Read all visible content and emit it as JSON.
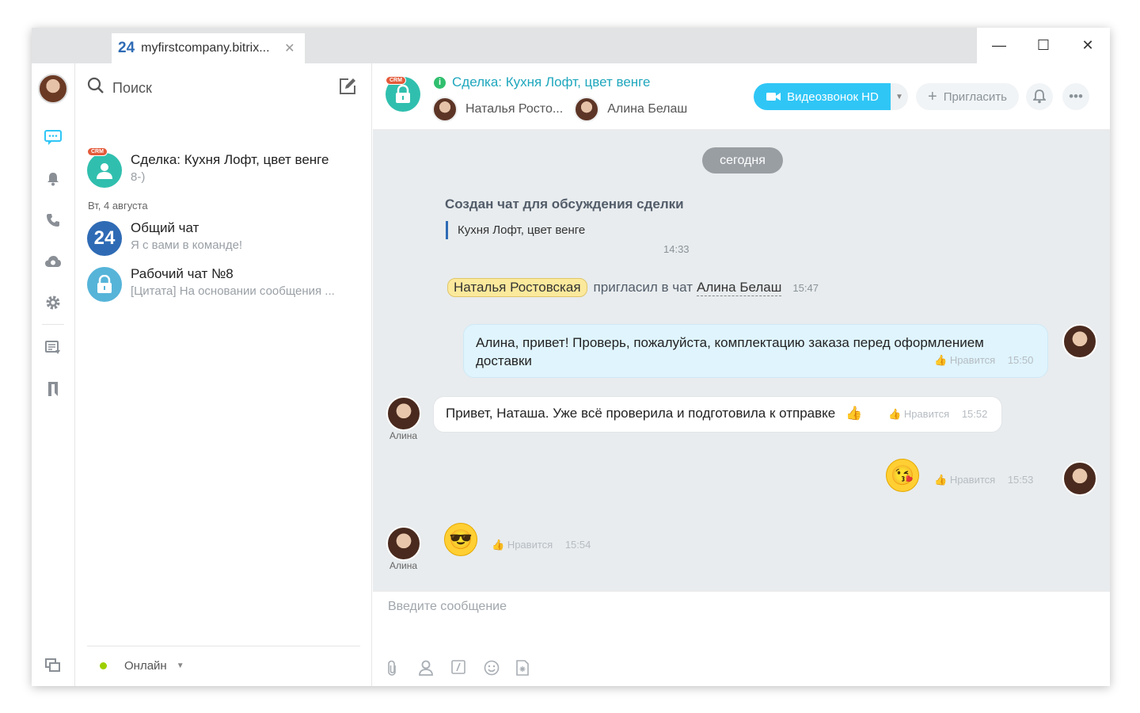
{
  "window": {
    "tab_logo": "24",
    "tab_title": "myfirstcompany.bitrix...",
    "tab_close": "✕",
    "minimize": "—",
    "maximize": "☐",
    "close": "✕"
  },
  "sidebar": {
    "active_color": "#2fc6f6"
  },
  "search": {
    "placeholder": "Поиск"
  },
  "chat_list": {
    "date_separator": "Вт, 4 августа",
    "items": [
      {
        "name": "Сделка: Кухня Лофт, цвет венге",
        "preview": "8-)",
        "badge": "CRM"
      },
      {
        "name": "Общий чат",
        "preview": "Я с вами в команде!",
        "avatar_text": "24"
      },
      {
        "name": "Рабочий чат №8",
        "preview": "[Цитата] На основании сообщения ..."
      }
    ]
  },
  "status": {
    "label": "Онлайн"
  },
  "chat": {
    "badge": "CRM",
    "title": "Сделка: Кухня Лофт, цвет венге",
    "members": [
      "Наталья Росто...",
      "Алина Белаш"
    ],
    "video_button": "Видеозвонок HD",
    "invite_button": "Пригласить",
    "date_pill": "сегодня",
    "system_message": "Создан чат для обсуждения сделки",
    "system_quote": "Кухня Лофт, цвет венге",
    "system_time": "14:33",
    "invite_event": {
      "actor": "Наталья Ростовская",
      "action": "пригласил в чат",
      "target": "Алина Белаш",
      "time": "15:47"
    },
    "messages": [
      {
        "author": "me",
        "text": "Алина, привет! Проверь, пожалуйста, комплектацию заказа перед оформлением доставки",
        "like": "Нравится",
        "time": "15:50"
      },
      {
        "author": "Алина",
        "text": "Привет, Наташа. Уже всё проверила и подготовила к отправке",
        "emoji": "👍",
        "like": "Нравится",
        "time": "15:52"
      },
      {
        "author": "me",
        "emoji": "😘",
        "like": "Нравится",
        "time": "15:53"
      },
      {
        "author": "Алина",
        "emoji": "😎",
        "like": "Нравится",
        "time": "15:54"
      }
    ],
    "input_placeholder": "Введите сообщение"
  }
}
